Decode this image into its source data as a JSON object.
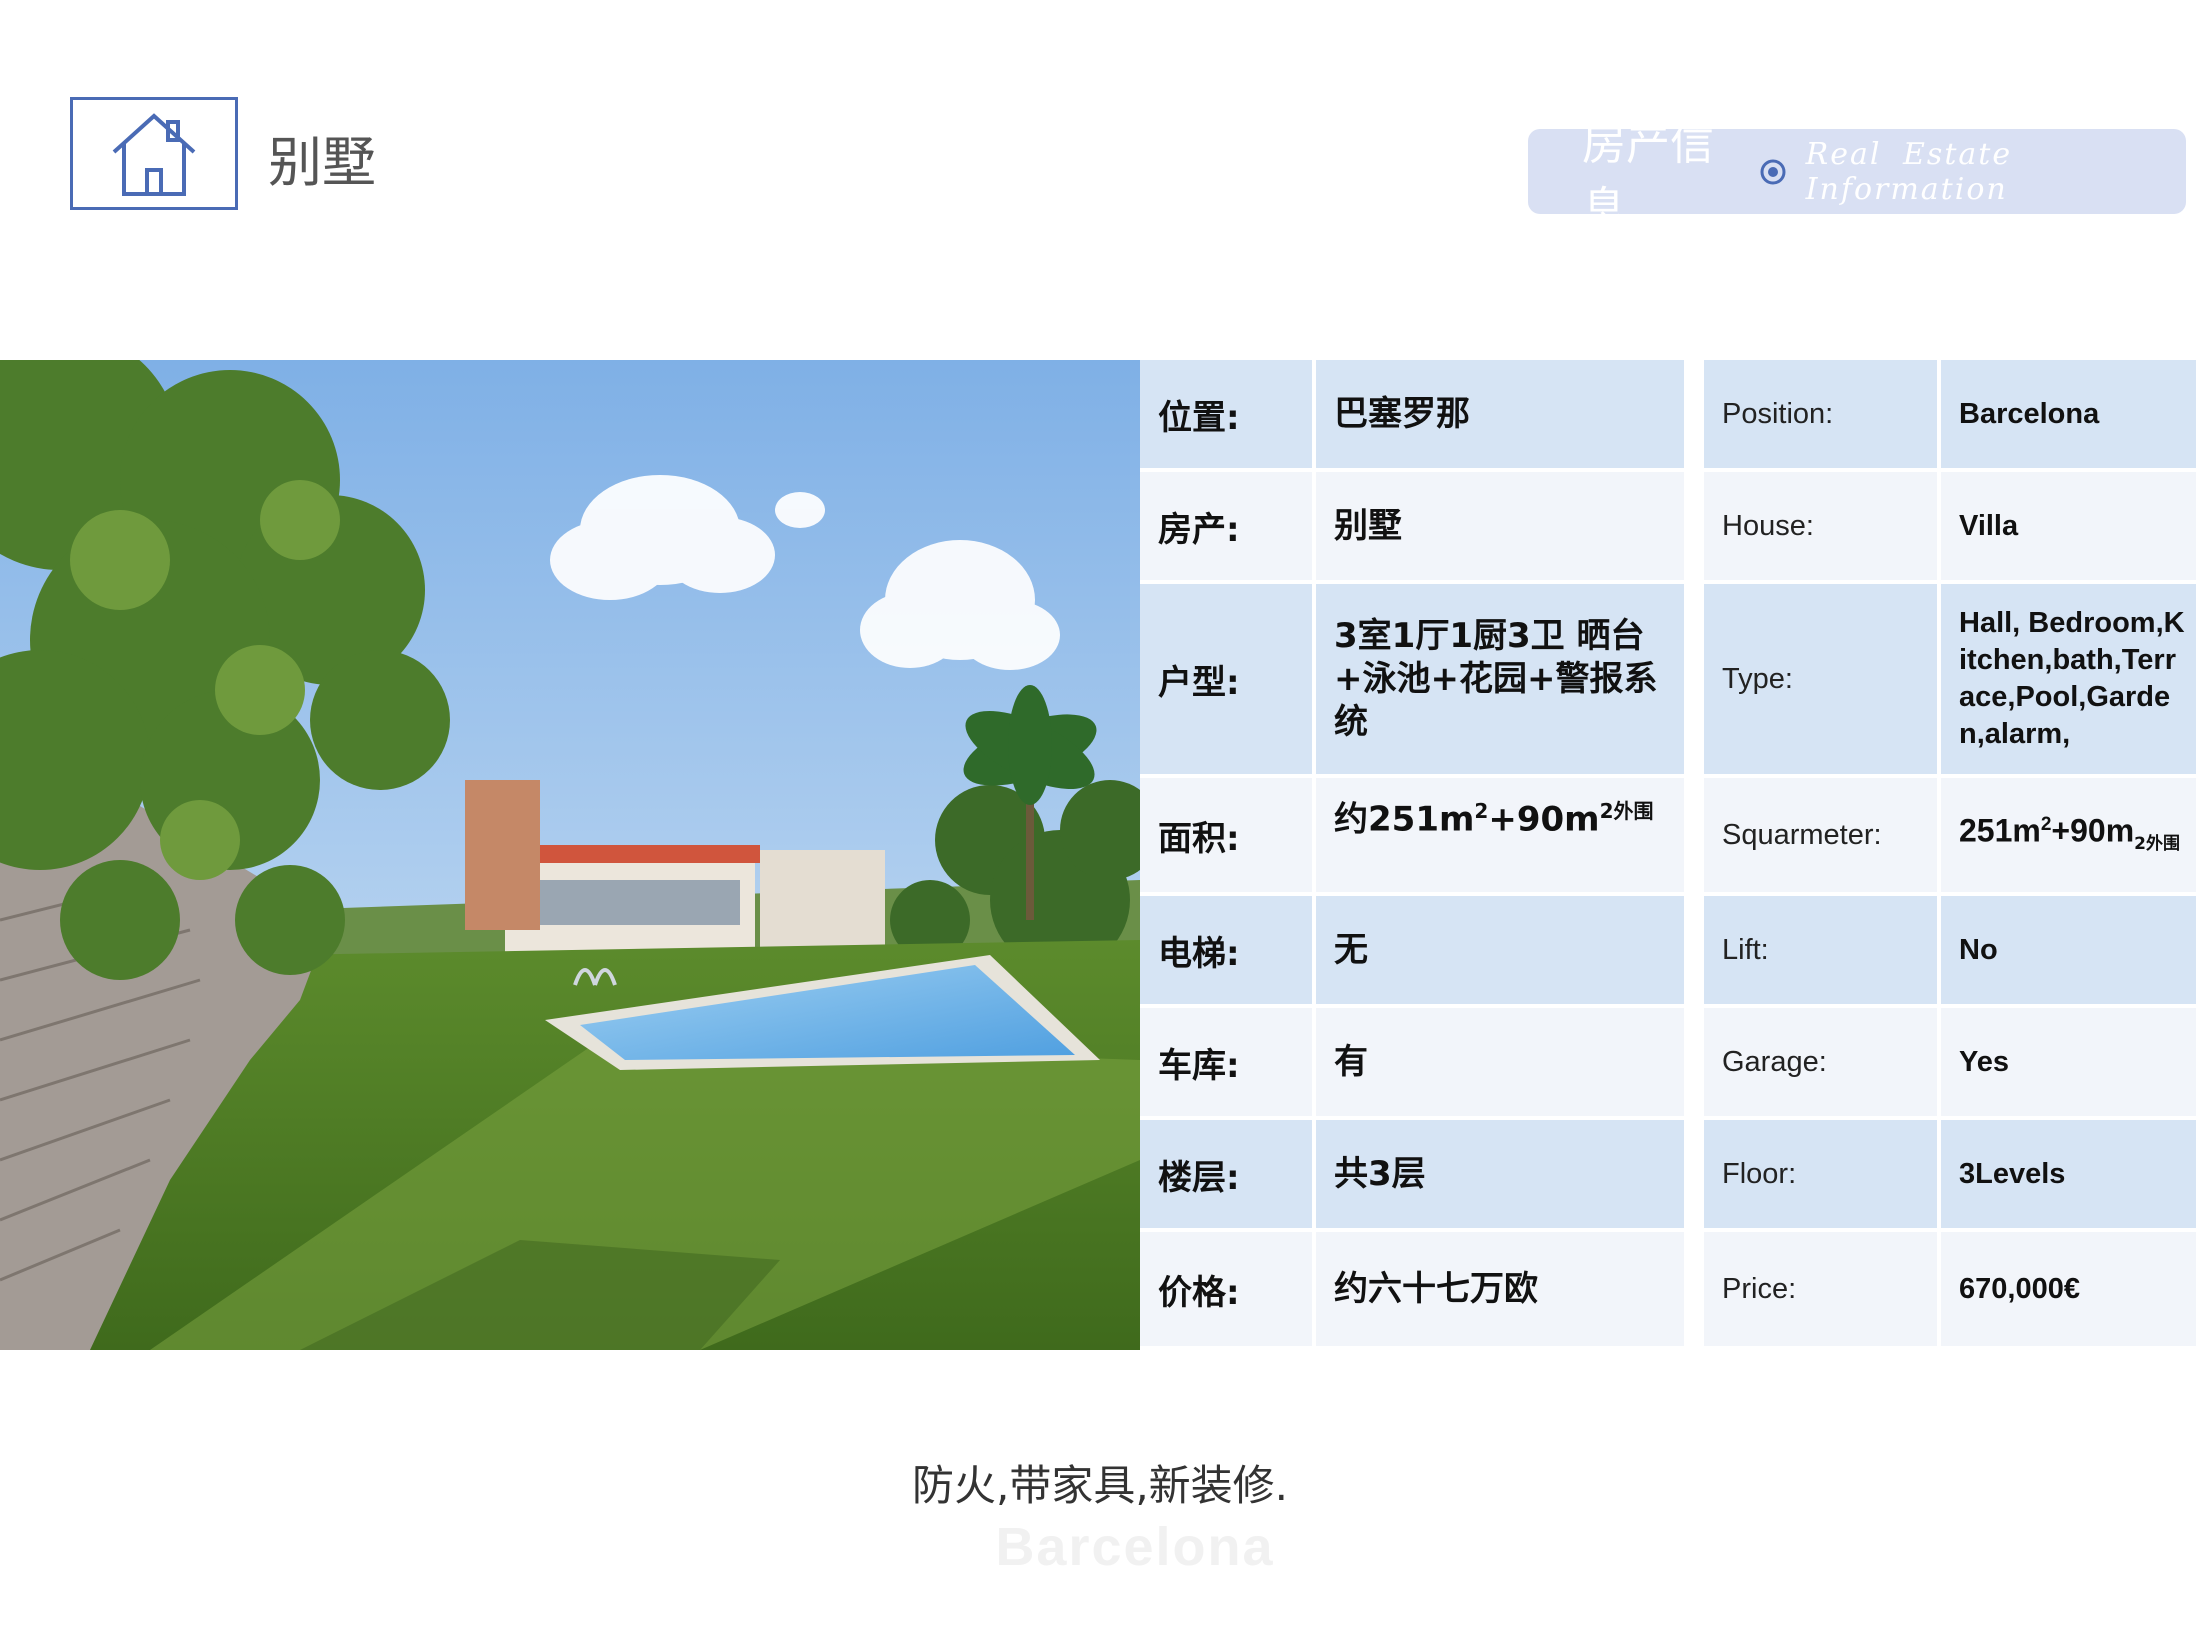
{
  "header": {
    "title": "别墅"
  },
  "banner": {
    "cn": "房产信息",
    "en": "Real Estate Information"
  },
  "table": {
    "rows": [
      {
        "cn_label": "位置:",
        "cn_value": "巴塞罗那",
        "en_label": "Position:",
        "en_value": "Barcelona"
      },
      {
        "cn_label": "房产:",
        "cn_value": "别墅",
        "en_label": "House:",
        "en_value": "Villa"
      },
      {
        "cn_label": "户型:",
        "cn_value": "3室1厅1厨3卫 晒台+泳池+花园+警报系统",
        "en_label": "Type:",
        "en_value": "Hall, Bedroom,Kitchen,bath,Terrace,Pool,Garden,alarm,"
      },
      {
        "cn_label": "面积:",
        "cn_value": "约251m",
        "cn_value_sup": "2",
        "cn_value_mid": "+90m",
        "cn_value_sup2": "2外围",
        "en_label": "Squarmeter:",
        "en_value": "251m",
        "en_value_sup": "2",
        "en_value_mid": "+90m",
        "en_value_sub": "2外围"
      },
      {
        "cn_label": "电梯:",
        "cn_value": "无",
        "en_label": "Lift:",
        "en_value": "No"
      },
      {
        "cn_label": "车库:",
        "cn_value": "有",
        "en_label": "Garage:",
        "en_value": "Yes"
      },
      {
        "cn_label": "楼层:",
        "cn_value": "共3层",
        "en_label": "Floor:",
        "en_value": "3Levels"
      },
      {
        "cn_label": "价格:",
        "cn_value": "约六十七万欧",
        "en_label": "Price:",
        "en_value": "670,000€"
      }
    ]
  },
  "footer": {
    "note": "防火,带家具,新装修.",
    "watermark": "Barcelona"
  },
  "colors": {
    "accent": "#4a6bb5",
    "banner_bg": "#d9e0f3",
    "row_dark": "#d6e4f4",
    "row_light": "#f2f5fa"
  },
  "icons": {
    "logo": "house-icon",
    "banner_dot": "target-circle-icon"
  }
}
